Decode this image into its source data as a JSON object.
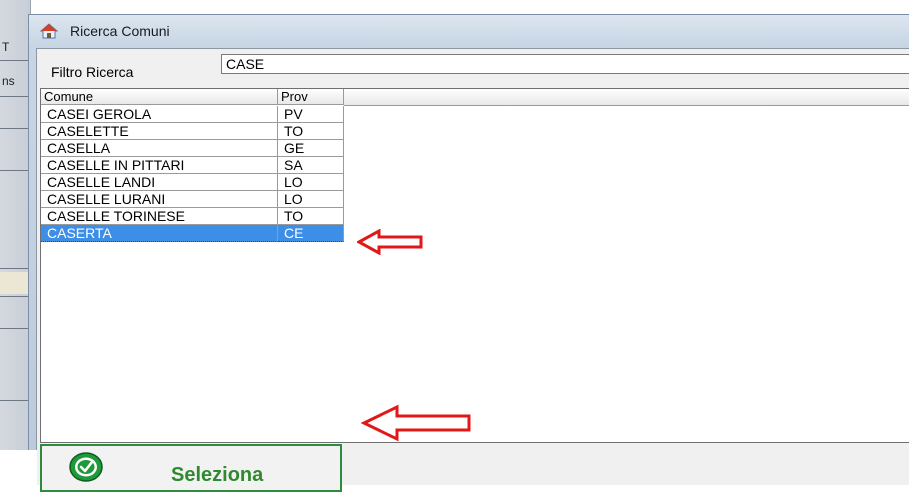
{
  "background": {
    "glyphs": [
      "T",
      "ns"
    ]
  },
  "window": {
    "title": "Ricerca Comuni",
    "title_icon": "home-icon"
  },
  "filter": {
    "label": "Filtro Ricerca",
    "value": "CASE"
  },
  "table": {
    "columns": [
      "Comune",
      "Prov"
    ],
    "rows": [
      {
        "comune": "CASEI GEROLA",
        "prov": "PV"
      },
      {
        "comune": "CASELETTE",
        "prov": "TO"
      },
      {
        "comune": "CASELLA",
        "prov": "GE"
      },
      {
        "comune": "CASELLE IN PITTARI",
        "prov": "SA"
      },
      {
        "comune": "CASELLE LANDI",
        "prov": "LO"
      },
      {
        "comune": "CASELLE LURANI",
        "prov": "LO"
      },
      {
        "comune": "CASELLE TORINESE",
        "prov": "TO"
      },
      {
        "comune": "CASERTA",
        "prov": "CE"
      }
    ],
    "selected_index": 7
  },
  "actions": {
    "select_label": "Seleziona",
    "select_icon": "green-check-circle-icon"
  },
  "colors": {
    "selection": "#3d8ee6",
    "accent_green": "#2f8a2f",
    "arrow_red": "#e01818"
  }
}
